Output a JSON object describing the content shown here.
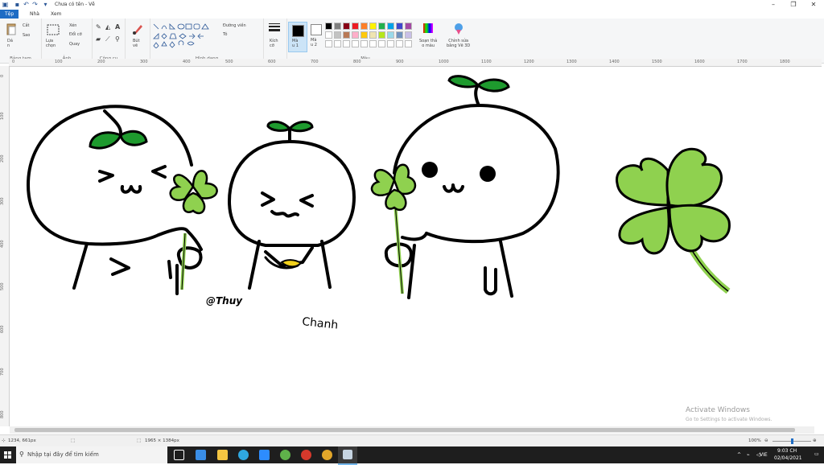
{
  "window": {
    "title": "Chưa có tên - Vẽ",
    "controls": {
      "minimize": "–",
      "maximize": "❐",
      "close": "✕"
    }
  },
  "quick_access": {
    "icons": [
      "paint-app-icon",
      "save-icon",
      "undo-icon",
      "redo-icon",
      "customize-icon"
    ]
  },
  "tabs": [
    {
      "label": "Tệp",
      "active": true
    },
    {
      "label": "Nhà",
      "active": false
    },
    {
      "label": "Xem",
      "active": false
    }
  ],
  "ribbon": {
    "clipboard": {
      "label": "Bảng tạm",
      "paste": "Dá\nn",
      "cut": "Cắt",
      "copy": "Sao"
    },
    "image": {
      "label": "Ảnh",
      "select": "Lựa\nchọn",
      "crop": "Xén",
      "resize": "Đổi cỡ",
      "rotate": "Quay"
    },
    "tools": {
      "label": "Công cụ"
    },
    "brushes": {
      "label": "Bút\nvẽ"
    },
    "shapes": {
      "label": "Hình dạng",
      "outline": "Đường viền",
      "fill": "Tô"
    },
    "size": {
      "label": "Kích\ncỡ"
    },
    "color1": {
      "label": "Mà\nu 1"
    },
    "color2": {
      "label": "Mà\nu 2"
    },
    "colors": {
      "label": "Màu",
      "edit": "Soạn thả\no màu",
      "paint3d": "Chỉnh sửa\nbằng Vẽ 3D"
    },
    "palette": [
      "#000000",
      "#7f7f7f",
      "#880015",
      "#ed1c24",
      "#ff7f27",
      "#fff200",
      "#22b14c",
      "#00a2e8",
      "#3f48cc",
      "#a349a4",
      "#ffffff",
      "#c3c3c3",
      "#b97a57",
      "#ffaec9",
      "#ffc90e",
      "#efe4b0",
      "#b5e61d",
      "#99d9ea",
      "#7092be",
      "#c8bfe7",
      "#ffffff",
      "#ffffff",
      "#ffffff",
      "#ffffff",
      "#ffffff",
      "#ffffff",
      "#ffffff",
      "#ffffff",
      "#ffffff",
      "#ffffff"
    ]
  },
  "ruler": {
    "h_ticks": [
      "0",
      "100",
      "200",
      "300",
      "400",
      "500",
      "600",
      "700",
      "800",
      "900",
      "1000",
      "1100",
      "1200",
      "1300",
      "1400",
      "1500",
      "1600",
      "1700",
      "1800"
    ],
    "v_ticks": [
      "0",
      "100",
      "200",
      "300",
      "400",
      "500",
      "600",
      "700",
      "800"
    ]
  },
  "canvas": {
    "signature": "@Thuy",
    "handwriting": "Chanh"
  },
  "watermark": {
    "line1": "Activate Windows",
    "line2": "Go to Settings to activate Windows."
  },
  "status": {
    "cursor_pos": "1234, 661px",
    "image_size": "1965 × 1384px",
    "zoom": "100%"
  },
  "taskbar": {
    "search_placeholder": "Nhập tại đây để tìm kiếm",
    "time": "9:03 CH",
    "date": "02/04/2021",
    "lang": "VIE"
  }
}
